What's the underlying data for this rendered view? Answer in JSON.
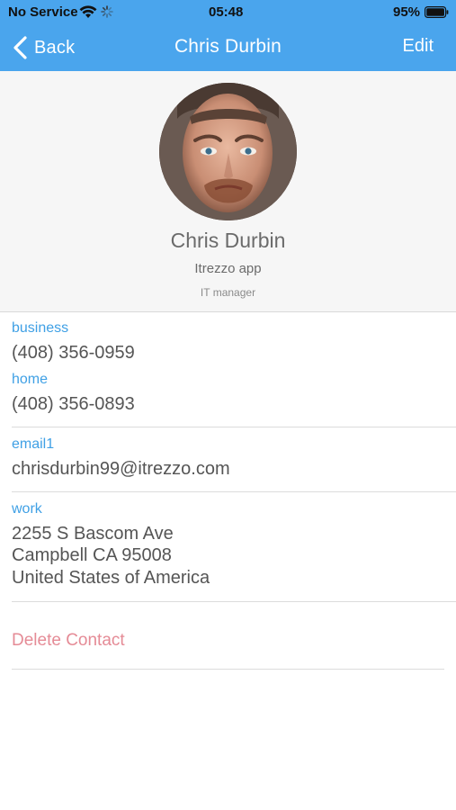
{
  "status_bar": {
    "carrier": "No Service",
    "time": "05:48",
    "battery_percent": "95%",
    "battery_level": 0.95,
    "icons": [
      "wifi-icon",
      "loading-spinner-icon",
      "battery-icon"
    ]
  },
  "nav": {
    "back_label": "Back",
    "title": "Chris Durbin",
    "edit_label": "Edit"
  },
  "contact": {
    "name": "Chris Durbin",
    "company": "Itrezzo app",
    "job_title": "IT manager"
  },
  "phones": [
    {
      "label": "business",
      "value": "(408) 356-0959"
    },
    {
      "label": "home",
      "value": "(408) 356-0893"
    }
  ],
  "emails": [
    {
      "label": "email1",
      "value": "chrisdurbin99@itrezzo.com"
    }
  ],
  "addresses": [
    {
      "label": "work",
      "lines": [
        "2255 S Bascom Ave",
        "Campbell CA 95008",
        "United States of America"
      ]
    }
  ],
  "actions": {
    "delete_label": "Delete Contact"
  },
  "colors": {
    "nav_bar": "#4aa5ed",
    "field_label": "#3fa0e5",
    "delete": "#e58b96"
  }
}
